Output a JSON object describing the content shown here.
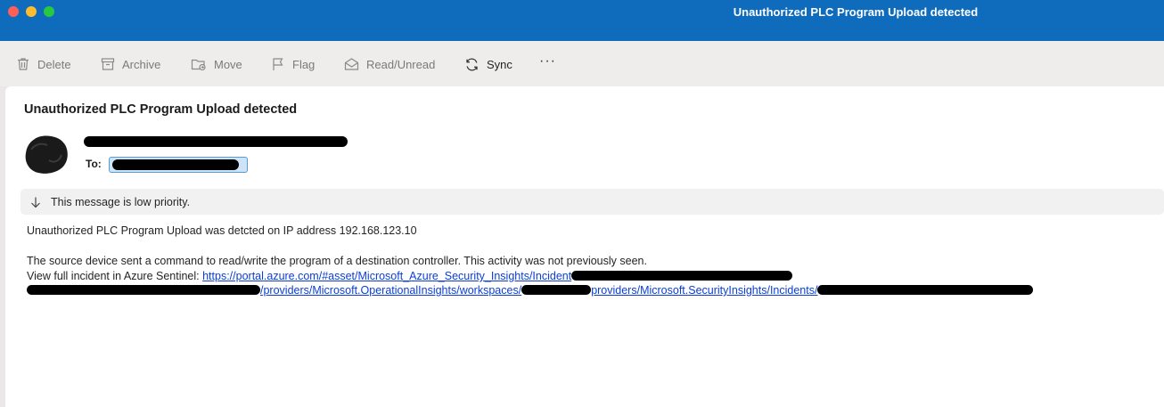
{
  "window": {
    "title": "Unauthorized PLC Program Upload detected"
  },
  "toolbar": {
    "delete_label": "Delete",
    "archive_label": "Archive",
    "move_label": "Move",
    "flag_label": "Flag",
    "read_unread_label": "Read/Unread",
    "sync_label": "Sync",
    "more_label": "···"
  },
  "message": {
    "subject": "Unauthorized PLC Program Upload detected",
    "to_label": "To:",
    "priority_notice": "This message is low priority.",
    "body_line1": "Unauthorized PLC Program Upload was detcted on IP address 192.168.123.10",
    "body_line2": "The source device sent a command to read/write the program of a destination controller. This activity was not previously seen.",
    "incident_prefix": "View full incident in Azure Sentinel: ",
    "link_part1": "https://portal.azure.com/#asset/Microsoft_Azure_Security_Insights/Incident",
    "link_part2": "/providers/Microsoft.OperationalInsights/workspaces/",
    "link_part3": "providers/Microsoft.SecurityInsights/Incidents/"
  },
  "colors": {
    "titlebar": "#0f6cbd",
    "link": "#0b3ed6",
    "toolbar_bg": "#efedec"
  },
  "icons": [
    "trash-icon",
    "archive-icon",
    "move-icon",
    "flag-icon",
    "envelope-icon",
    "sync-icon",
    "more-icon",
    "down-arrow-icon",
    "avatar"
  ]
}
